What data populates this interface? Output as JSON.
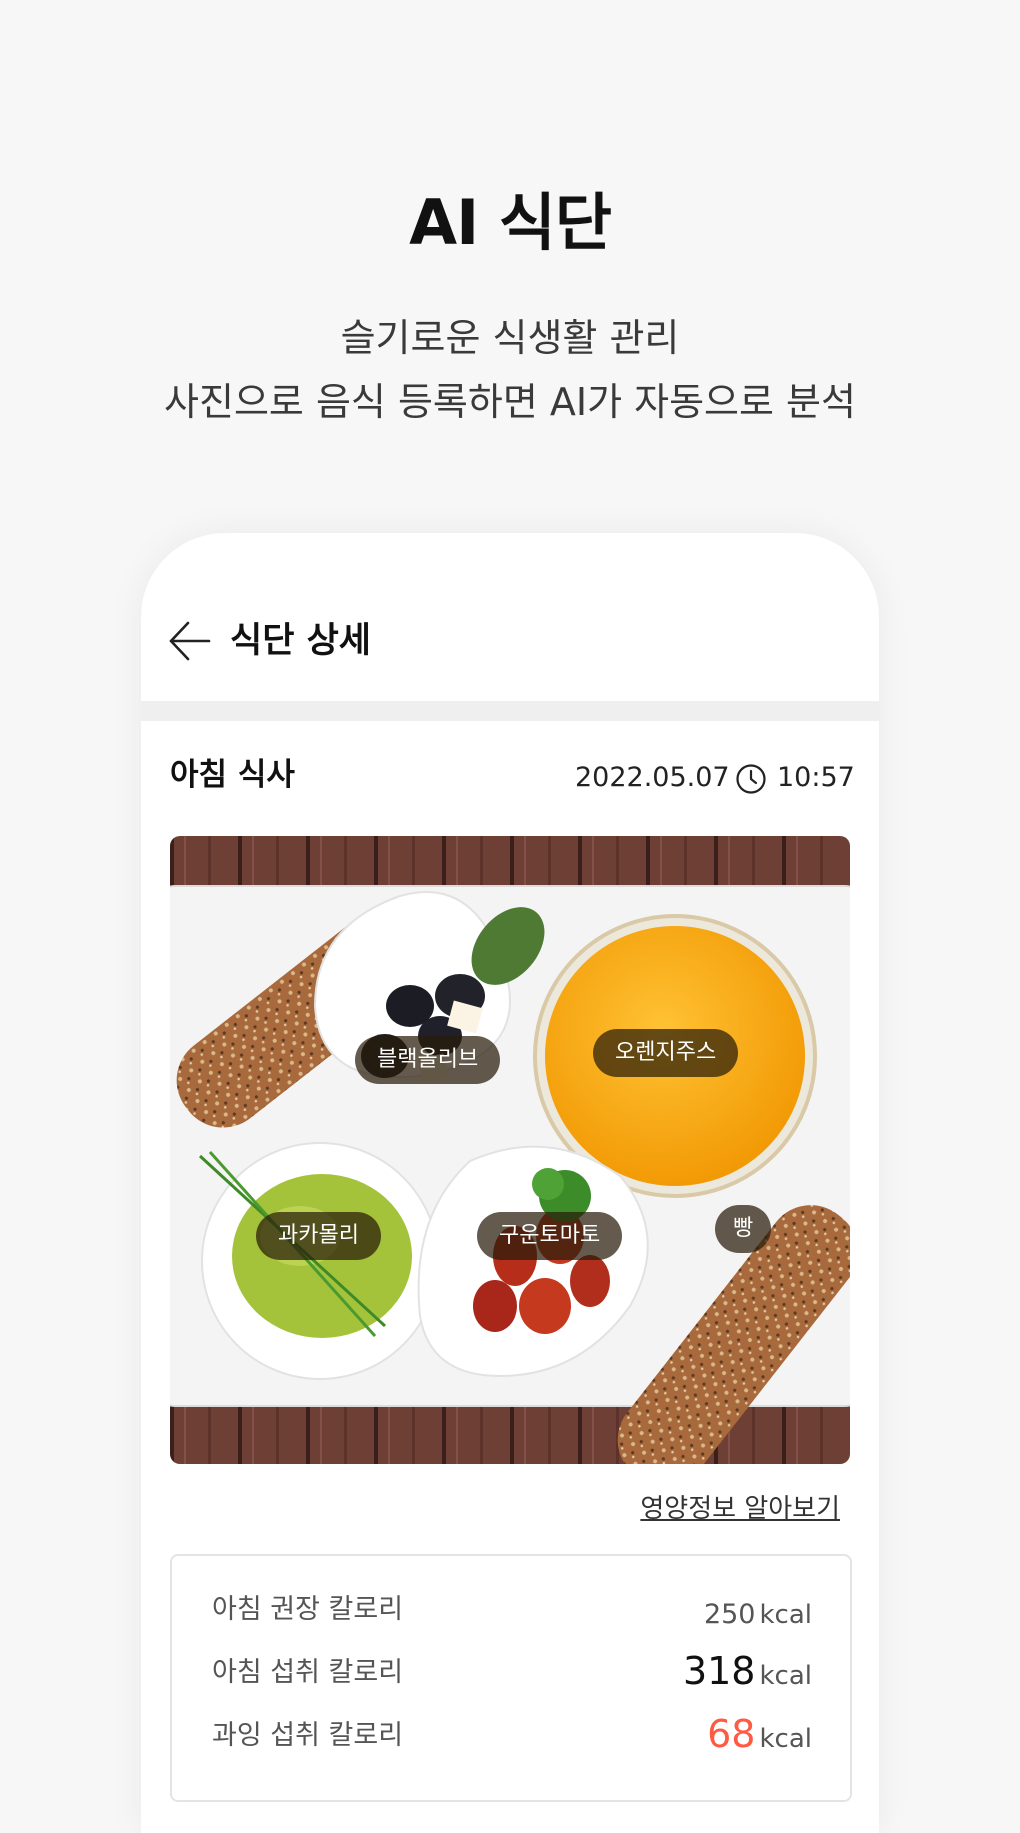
{
  "hero": {
    "title": "AI 식단",
    "subtitle_line1": "슬기로운 식생활 관리",
    "subtitle_line2": "사진으로 음식 등록하면 AI가 자동으로 분석"
  },
  "app": {
    "header_title": "식단 상세",
    "back_icon": "arrow-left-icon"
  },
  "meal": {
    "title": "아침 식사",
    "date": "2022.05.07",
    "time": "10:57",
    "time_icon": "clock-icon",
    "food_tags": [
      "블랙올리브",
      "오렌지주스",
      "빵",
      "과카몰리",
      "구운토마토"
    ],
    "nutrition_link": "영양정보 알아보기"
  },
  "calories": {
    "rows": [
      {
        "label": "아침 권장 칼로리",
        "value": "250",
        "unit": "kcal"
      },
      {
        "label": "아침 섭취 칼로리",
        "value": "318",
        "unit": "kcal"
      },
      {
        "label": "과잉 섭취 칼로리",
        "value": "68",
        "unit": "kcal"
      }
    ],
    "excess_color": "#ff5a42"
  }
}
